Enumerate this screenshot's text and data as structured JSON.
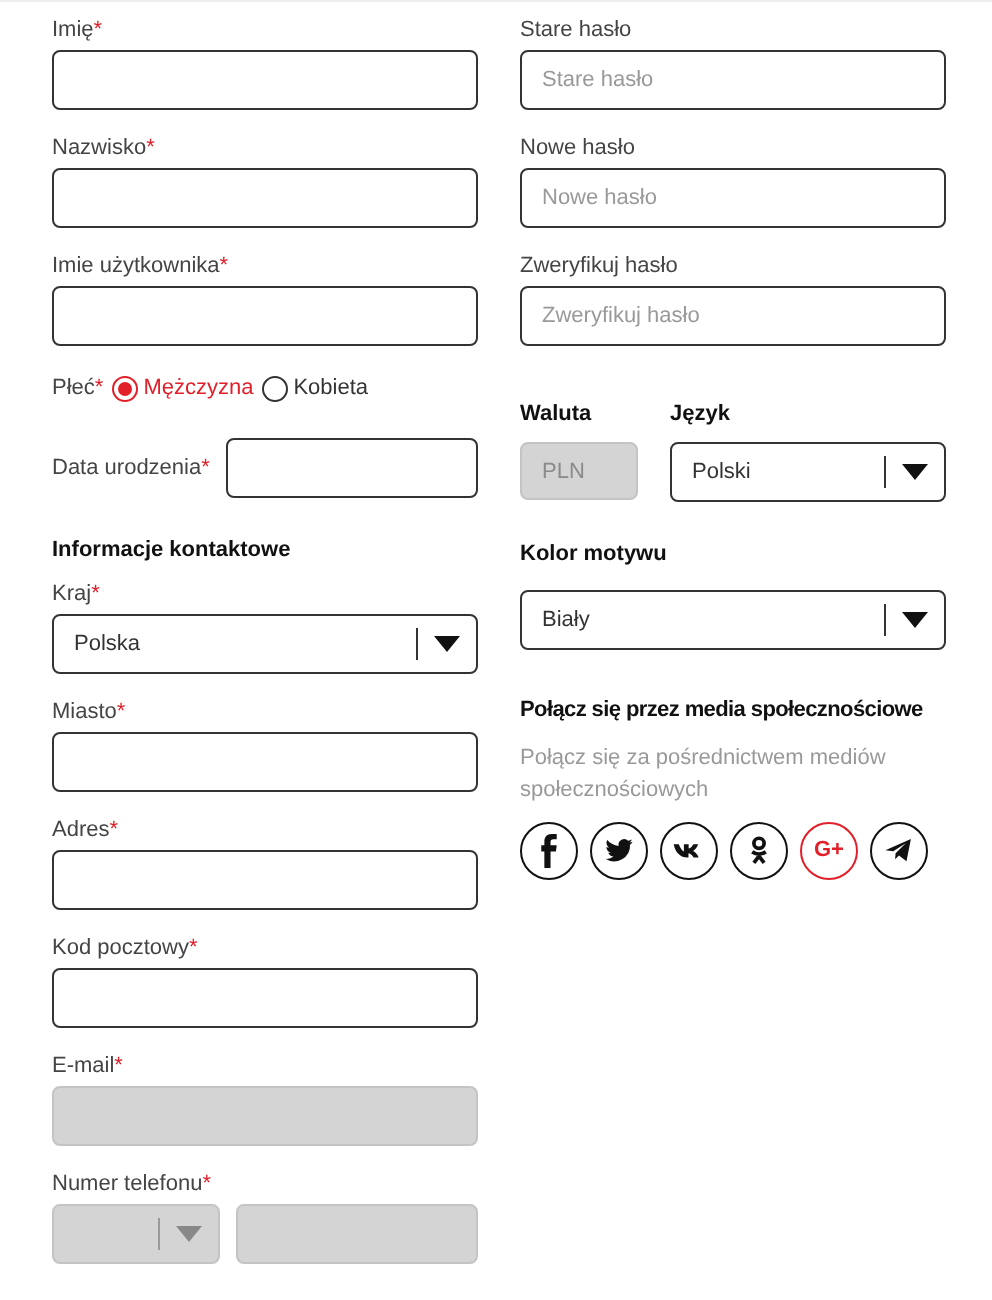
{
  "left": [
    {
      "kind": "text",
      "label": "Imię",
      "required": "*",
      "disabled": false
    },
    {
      "kind": "text",
      "label": "Nazwisko",
      "required": "*",
      "disabled": false
    },
    {
      "kind": "text",
      "label": "Imie użytkownika",
      "required": "*",
      "disabled": false
    },
    {
      "kind": "radio",
      "label": "Płeć",
      "required": "*",
      "options": [
        {
          "label": "Mężczyzna",
          "selected": true
        },
        {
          "label": "Kobieta",
          "selected": false
        }
      ]
    },
    {
      "kind": "inline",
      "label": "Data urodzenia",
      "required": "*"
    },
    {
      "kind": "heading",
      "label": "Informacje kontaktowe"
    },
    {
      "kind": "select",
      "label": "Kraj",
      "required": "*",
      "value": "Polska"
    },
    {
      "kind": "text",
      "label": "Miasto",
      "required": "*",
      "disabled": false
    },
    {
      "kind": "text",
      "label": "Adres",
      "required": "*",
      "disabled": false
    },
    {
      "kind": "text",
      "label": "Kod pocztowy",
      "required": "*",
      "disabled": false
    },
    {
      "kind": "text",
      "label": "E-mail",
      "required": "*",
      "disabled": true
    },
    {
      "kind": "phone",
      "label": "Numer telefonu",
      "required": "*",
      "disabled": true
    }
  ],
  "passwords": [
    {
      "label": "Stare hasło",
      "placeholder": "Stare hasło"
    },
    {
      "label": "Nowe hasło",
      "placeholder": "Nowe hasło"
    },
    {
      "label": "Zweryfikuj hasło",
      "placeholder": "Zweryfikuj hasło"
    }
  ],
  "currency": {
    "label": "Waluta",
    "value": "PLN",
    "disabled": true
  },
  "language": {
    "label": "Język",
    "value": "Polski"
  },
  "theme": {
    "label": "Kolor motywu",
    "value": "Biały"
  },
  "social": {
    "title": "Połącz się przez media społecznościowe",
    "description": "Połącz się za pośrednictwem mediów społecznościowych",
    "icons": [
      {
        "kind": "facebook",
        "color": "#111111"
      },
      {
        "kind": "twitter",
        "color": "#111111"
      },
      {
        "kind": "vk",
        "color": "#111111"
      },
      {
        "kind": "ok",
        "color": "#111111"
      },
      {
        "kind": "text",
        "text": "G+",
        "color": "#e2202a"
      },
      {
        "kind": "telegram",
        "color": "#111111"
      }
    ]
  }
}
